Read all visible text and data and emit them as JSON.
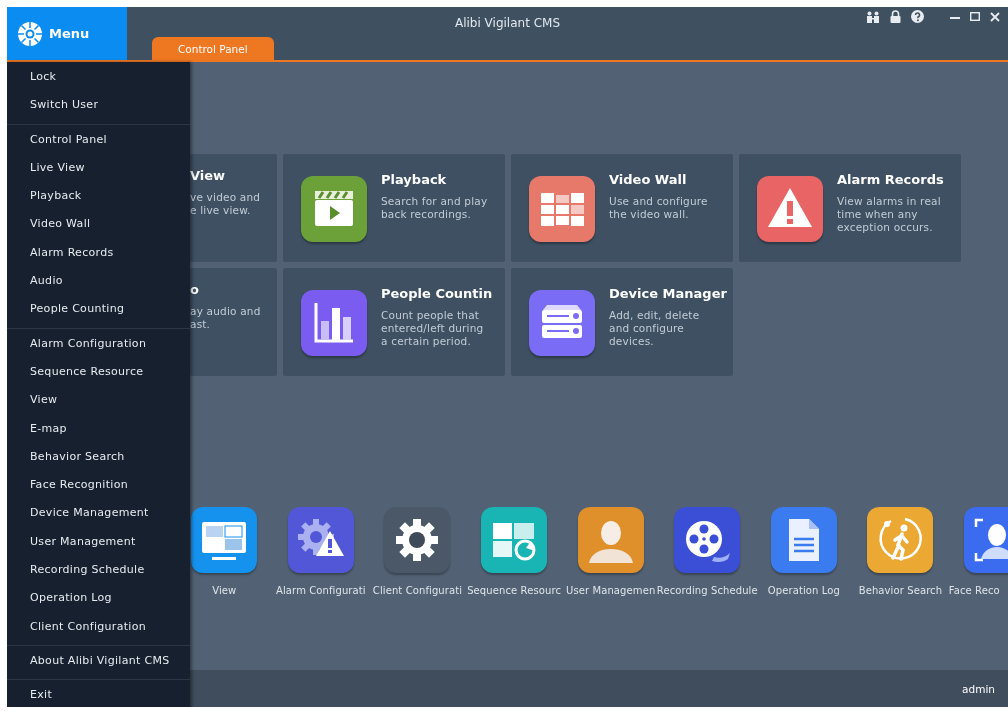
{
  "window": {
    "title": "Alibi Vigilant CMS"
  },
  "menu_button": {
    "label": "Menu"
  },
  "tabs": [
    {
      "label": "Control Panel",
      "selected": true
    }
  ],
  "menu": {
    "groups": [
      [
        "Lock",
        "Switch User"
      ],
      [
        "Control Panel",
        "Live View",
        "Playback",
        "Video Wall",
        "Alarm Records",
        "Audio",
        "People Counting"
      ],
      [
        "Alarm Configuration",
        "Sequence Resource",
        "View",
        "E-map",
        "Behavior Search",
        "Face Recognition",
        "Device Management",
        "User Management",
        "Recording Schedule",
        "Operation Log",
        "Client Configuration"
      ],
      [
        "About Alibi Vigilant CMS"
      ],
      [
        "Exit"
      ]
    ]
  },
  "cards": [
    {
      "kind": "partial",
      "title": "View",
      "description": "ve video and\ne live view."
    },
    {
      "kind": "full",
      "title": "Playback",
      "description": "Search for and play\nback recordings."
    },
    {
      "kind": "full",
      "title": "Video Wall",
      "description": "Use and configure\nthe video wall."
    },
    {
      "kind": "full",
      "title": "Alarm Records",
      "description": "View alarms in real\ntime when any\nexception occurs."
    },
    {
      "kind": "partial",
      "title": "o",
      "description": "ay audio and\nast."
    },
    {
      "kind": "full",
      "title": "People Countin",
      "description": "Count people that\nentered/left during\na certain period."
    },
    {
      "kind": "full",
      "title": "Device Manager",
      "description": "Add, edit, delete\nand configure\ndevices."
    }
  ],
  "tiles": [
    {
      "label": "View"
    },
    {
      "label": "Alarm Configurati"
    },
    {
      "label": "Client Configurati"
    },
    {
      "label": "Sequence Resourc"
    },
    {
      "label": "User Managemen"
    },
    {
      "label": "Recording Schedule"
    },
    {
      "label": "Operation Log"
    },
    {
      "label": "Behavior Search"
    },
    {
      "label": "Face Reco"
    }
  ],
  "status_bar": {
    "user": "admin"
  }
}
